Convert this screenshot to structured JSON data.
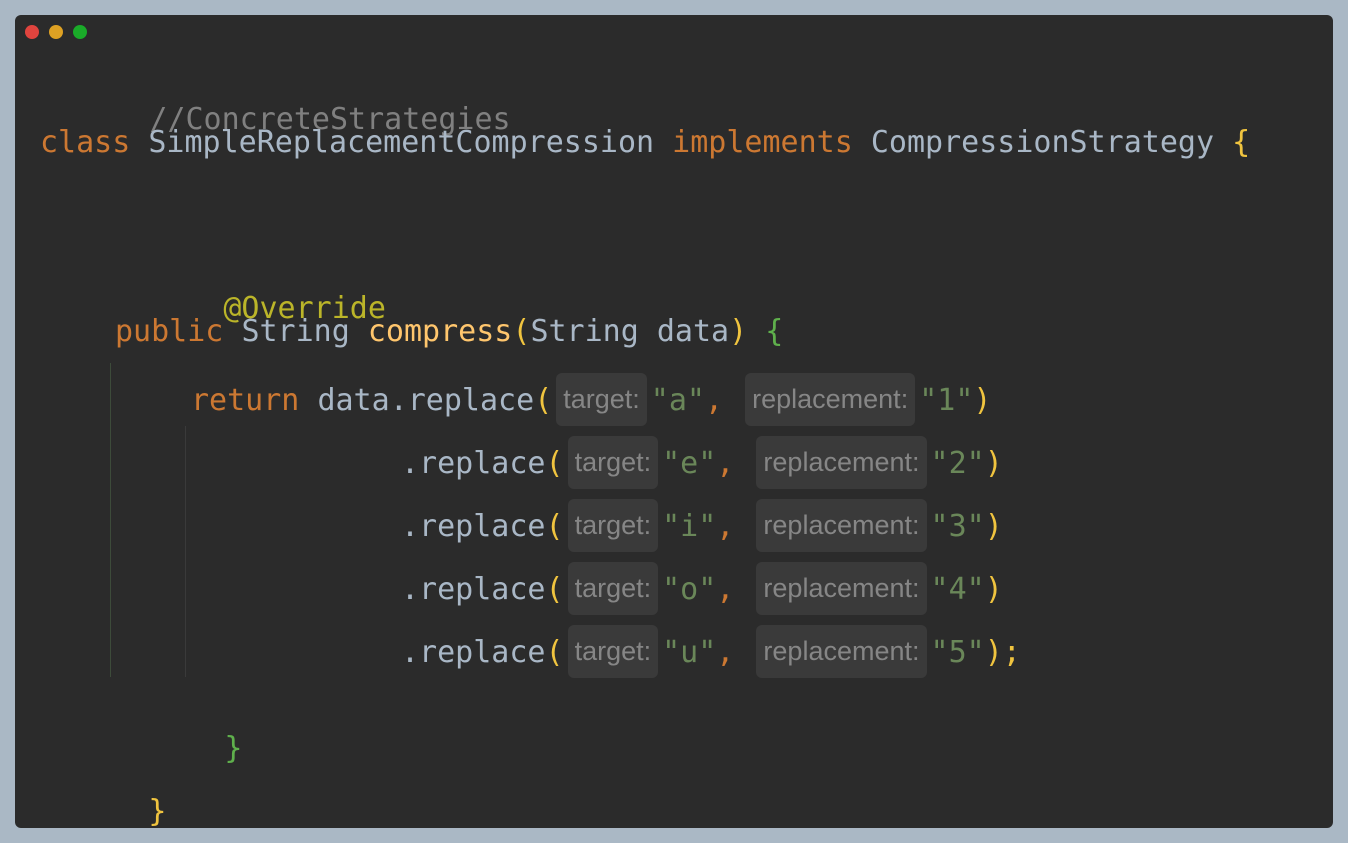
{
  "window_controls": {
    "close": "close",
    "minimize": "minimize",
    "zoom": "zoom"
  },
  "comment": "//ConcreteStrategies",
  "class_decl": {
    "kw_class": "class",
    "name": "SimpleReplacementCompression",
    "kw_implements": "implements",
    "iface": "CompressionStrategy",
    "open": "{"
  },
  "annotation": "@Override",
  "method_decl": {
    "kw_public": "public",
    "ret_type": "String",
    "name": "compress",
    "open_paren": "(",
    "param_type": "String",
    "param_name": "data",
    "close_paren": ")",
    "open_brace": "{"
  },
  "return_kw": "return",
  "receiver": "data",
  "replace_calls": [
    {
      "method": ".replace",
      "open": "(",
      "target_hint": "target:",
      "target": "\"a\"",
      "comma": ",",
      "replacement_hint": "replacement:",
      "replacement": "\"1\"",
      "close": ")"
    },
    {
      "method": ".replace",
      "open": "(",
      "target_hint": "target:",
      "target": "\"e\"",
      "comma": ",",
      "replacement_hint": "replacement:",
      "replacement": "\"2\"",
      "close": ")"
    },
    {
      "method": ".replace",
      "open": "(",
      "target_hint": "target:",
      "target": "\"i\"",
      "comma": ",",
      "replacement_hint": "replacement:",
      "replacement": "\"3\"",
      "close": ")"
    },
    {
      "method": ".replace",
      "open": "(",
      "target_hint": "target:",
      "target": "\"o\"",
      "comma": ",",
      "replacement_hint": "replacement:",
      "replacement": "\"4\"",
      "close": ")"
    },
    {
      "method": ".replace",
      "open": "(",
      "target_hint": "target:",
      "target": "\"u\"",
      "comma": ",",
      "replacement_hint": "replacement:",
      "replacement": "\"5\"",
      "close": ");"
    }
  ],
  "method_close": "}",
  "class_close": "}",
  "colors": {
    "background": "#2b2b2b",
    "outer": "#aab8c5",
    "keyword": "#cc7832",
    "function": "#ffc66d",
    "string": "#6a8759",
    "annotation": "#bbb529",
    "comment": "#808080"
  }
}
